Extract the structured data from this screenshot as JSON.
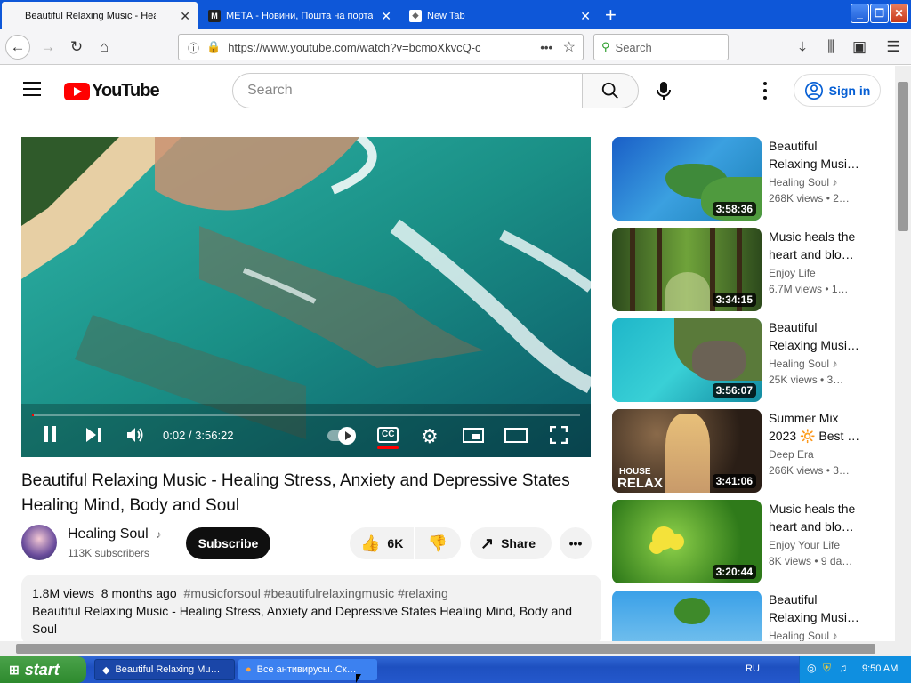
{
  "browser": {
    "tabs": [
      {
        "label": "Beautiful Relaxing Music - Healing",
        "active": true
      },
      {
        "label": "МЕТА - Новини, Пошта на портал",
        "active": false
      },
      {
        "label": "New Tab",
        "active": false
      }
    ],
    "url": "https://www.youtube.com/watch?v=bcmoXkvcQ-c",
    "search_placeholder": "Search"
  },
  "youtube": {
    "logo_text": "YouTube",
    "search_placeholder": "Search",
    "sign_in": "Sign in"
  },
  "player": {
    "time": "0:02 / 3:56:22",
    "progress": 0.0001,
    "cc_label": "CC"
  },
  "video": {
    "title": "Beautiful Relaxing Music - Healing Stress, Anxiety and Depressive States Healing Mind, Body and Soul",
    "channel": "Healing Soul",
    "subscribers": "113K subscribers",
    "subscribe_label": "Subscribe",
    "likes": "6K",
    "share_label": "Share",
    "views_date": "1.8M views  8 months ago",
    "hashtags": "#musicforsoul #beautifulrelaxingmusic #relaxing",
    "desc_line1": "Beautiful Relaxing Music - Healing Stress, Anxiety and Depressive States Healing Mind, Body and Soul",
    "desc_line2": "Beautiful Relaxing Music - Healing Stress, Anxiety and Depressive States Healing Mind, Body and Soul"
  },
  "recommendations": [
    {
      "title": "Beautiful Relaxing Musi…",
      "channel": "Healing Soul",
      "views": "268K views  • 2…",
      "duration": "3:58:36"
    },
    {
      "title": "Music heals the heart and blo…",
      "channel": "Enjoy Life",
      "views": "6.7M views  • 1…",
      "duration": "3:34:15"
    },
    {
      "title": "Beautiful Relaxing Musi…",
      "channel": "Healing Soul",
      "views": "25K views  • 3…",
      "duration": "3:56:07"
    },
    {
      "title": "Summer Mix 2023 🔆 Best …",
      "channel": "Deep Era",
      "views": "266K views  • 3…",
      "duration": "3:41:06",
      "thumb_text1": "HOUSE",
      "thumb_text2": "RELAX"
    },
    {
      "title": "Music heals the heart and blo…",
      "channel": "Enjoy Your Life",
      "views": "8K views  • 9 da…",
      "duration": "3:20:44"
    },
    {
      "title": "Beautiful Relaxing Musi…",
      "channel": "Healing Soul",
      "views": "",
      "duration": ""
    }
  ],
  "taskbar": {
    "start": "start",
    "tasks": [
      "Beautiful Relaxing Mu…",
      "Все антивирусы. Ск…"
    ],
    "lang": "RU",
    "clock": "9:50 AM"
  }
}
